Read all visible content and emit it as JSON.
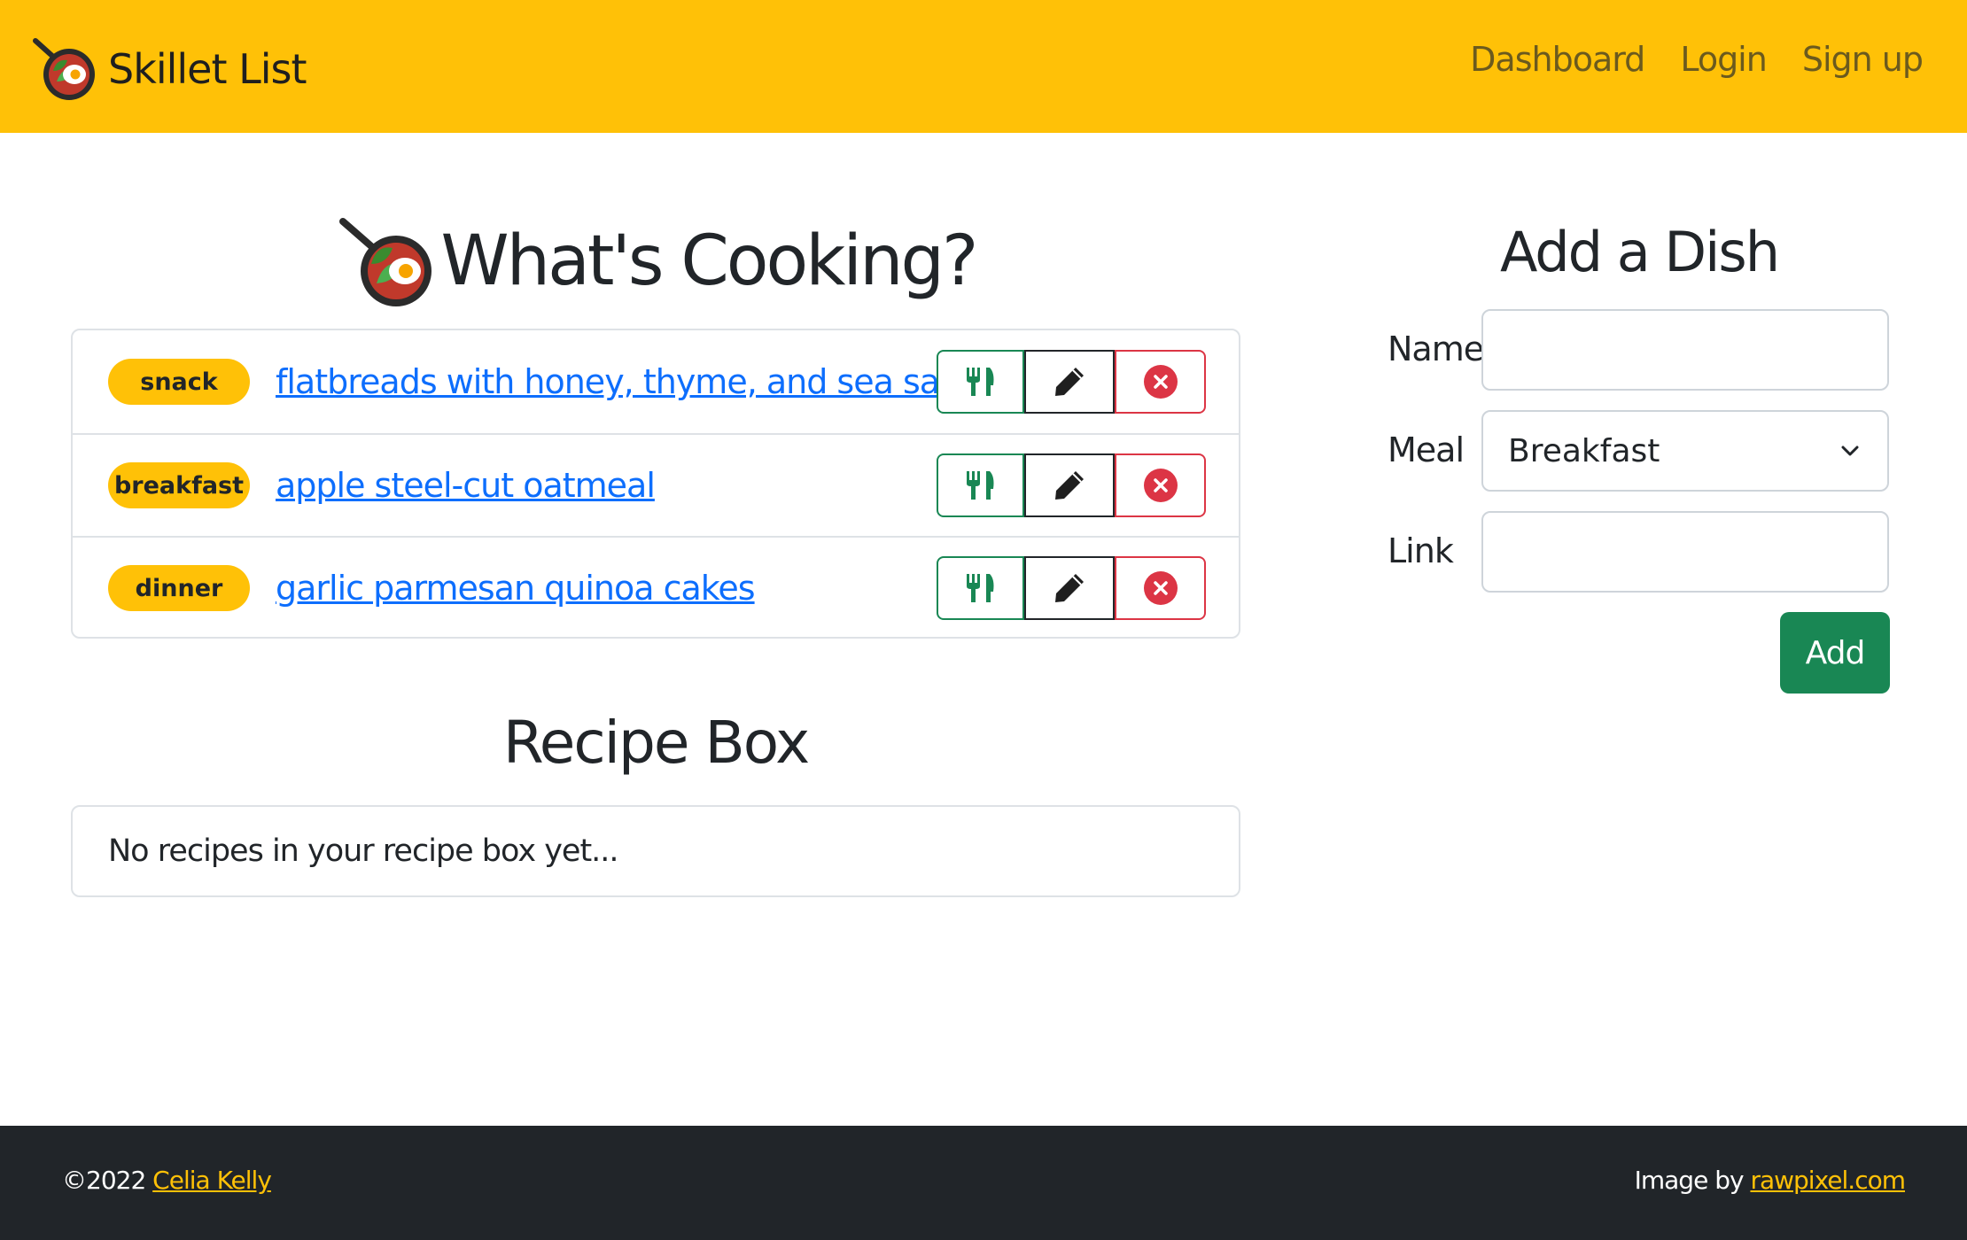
{
  "brand": {
    "name": "Skillet List",
    "logo_icon": "skillet-egg-icon"
  },
  "nav": {
    "items": [
      "Dashboard",
      "Login",
      "Sign up"
    ]
  },
  "main": {
    "title": "What's Cooking?",
    "dishes": [
      {
        "meal": "snack",
        "name": "flatbreads with honey, thyme, and sea salt"
      },
      {
        "meal": "breakfast",
        "name": "apple steel-cut oatmeal"
      },
      {
        "meal": "dinner",
        "name": "garlic parmesan quinoa cakes"
      }
    ],
    "recipe_box": {
      "title": "Recipe Box",
      "empty_text": "No recipes in your recipe box yet..."
    }
  },
  "form": {
    "title": "Add a Dish",
    "name_label": "Name",
    "name_value": "",
    "meal_label": "Meal",
    "meal_value": "Breakfast",
    "link_label": "Link",
    "link_value": "",
    "submit_label": "Add"
  },
  "footer": {
    "copyright": "©2022",
    "author": "Celia Kelly",
    "credit_prefix": "Image by",
    "credit_link": "rawpixel.com"
  },
  "colors": {
    "primary": "#ffc107",
    "link": "#0d6efd",
    "success": "#198754",
    "danger": "#dc3545",
    "dark": "#212529"
  }
}
